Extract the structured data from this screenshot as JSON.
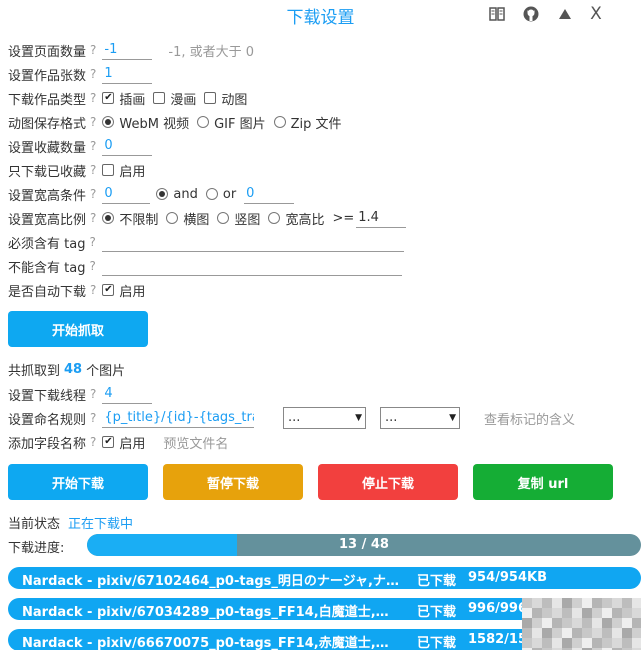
{
  "title": "下载设置",
  "toolbar": {
    "icons": [
      "book-icon",
      "github-icon",
      "triangle-up-icon"
    ],
    "close": "X"
  },
  "settings": {
    "page_count": {
      "label": "设置页面数量",
      "q": "?",
      "value": "-1",
      "hint": "-1, 或者大于 0"
    },
    "work_count": {
      "label": "设置作品张数",
      "q": "?",
      "value": "1"
    },
    "work_type": {
      "label": "下载作品类型",
      "q": "?",
      "options": [
        {
          "label": "插画",
          "checked": true
        },
        {
          "label": "漫画",
          "checked": false
        },
        {
          "label": "动图",
          "checked": false
        }
      ]
    },
    "ugoira_format": {
      "label": "动图保存格式",
      "q": "?",
      "options": [
        {
          "label": "WebM 视频",
          "checked": true
        },
        {
          "label": "GIF 图片",
          "checked": false
        },
        {
          "label": "Zip 文件",
          "checked": false
        }
      ]
    },
    "bookmark_count": {
      "label": "设置收藏数量",
      "q": "?",
      "value": "0"
    },
    "only_bookmarked": {
      "label": "只下载已收藏",
      "q": "?",
      "option": "启用",
      "checked": false
    },
    "size_condition": {
      "label": "设置宽高条件",
      "q": "?",
      "width": "0",
      "and": "and",
      "or": "or",
      "height": "0",
      "and_checked": true
    },
    "ratio": {
      "label": "设置宽高比例",
      "q": "?",
      "options": [
        {
          "label": "不限制",
          "checked": true
        },
        {
          "label": "横图",
          "checked": false
        },
        {
          "label": "竖图",
          "checked": false
        },
        {
          "label": "宽高比",
          "checked": false
        }
      ],
      "op": ">=",
      "value": "1.4"
    },
    "must_tag": {
      "label": "必须含有 tag",
      "q": "?",
      "value": ""
    },
    "exclude_tag": {
      "label": "不能含有 tag",
      "q": "?",
      "value": ""
    },
    "auto_download": {
      "label": "是否自动下载",
      "q": "?",
      "option": "启用",
      "checked": true
    }
  },
  "start_crawl": "开始抓取",
  "crawl_result": {
    "prefix": "共抓取到",
    "count": "48",
    "suffix": "个图片"
  },
  "threads": {
    "label": "设置下载线程",
    "q": "?",
    "value": "4"
  },
  "naming": {
    "label": "设置命名规则",
    "q": "?",
    "value": "{p_title}/{id}-{tags_tran",
    "select1": "...",
    "select2": "...",
    "link": "查看标记的含义"
  },
  "add_field": {
    "label": "添加字段名称",
    "q": "?",
    "option": "启用",
    "checked": true,
    "preview": "预览文件名"
  },
  "buttons": {
    "start": "开始下载",
    "pause": "暂停下载",
    "stop": "停止下载",
    "copy": "复制 url"
  },
  "status": {
    "label": "当前状态",
    "value": "正在下载中"
  },
  "progress": {
    "label": "下载进度:",
    "text": "13 / 48",
    "done": 13,
    "total": 48
  },
  "downloads": [
    {
      "name": "Nardack - pixiv/67102464_p0-tags_明日のナージャ,ナ...",
      "status": "已下载",
      "size": "954/954KB"
    },
    {
      "name": "Nardack - pixiv/67034289_p0-tags_FF14,白魔道士,whi...",
      "status": "已下载",
      "size": "996/996KB"
    },
    {
      "name": "Nardack - pixiv/66670075_p0-tags_FF14,赤魔道士,ミ...",
      "status": "已下载",
      "size": "1582/1582KB"
    }
  ],
  "colors": {
    "accent": "#1b9df3",
    "blue": "#0ea8f1",
    "orange": "#e7a20c",
    "red": "#f2403e",
    "green": "#15ad35",
    "track": "#64919c"
  }
}
